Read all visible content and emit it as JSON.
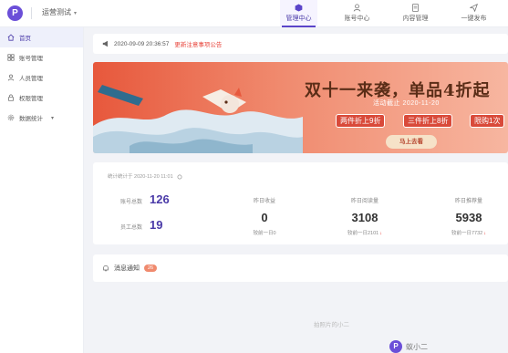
{
  "app": {
    "logo_glyph": "P",
    "org_name": "运营测试"
  },
  "top_nav": [
    {
      "label": "管理中心",
      "active": true
    },
    {
      "label": "账号中心",
      "active": false
    },
    {
      "label": "内容管理",
      "active": false
    },
    {
      "label": "一键发布",
      "active": false
    }
  ],
  "sidebar": {
    "items": [
      {
        "label": "首页",
        "icon": "home-icon",
        "active": true
      },
      {
        "label": "账号管理",
        "icon": "grid-icon",
        "active": false
      },
      {
        "label": "人员管理",
        "icon": "user-icon",
        "active": false
      },
      {
        "label": "权限管理",
        "icon": "lock-icon",
        "active": false
      },
      {
        "label": "数据统计",
        "icon": "settings-icon",
        "active": false
      }
    ]
  },
  "notice": {
    "time": "2020-09-09 20:36:57",
    "link_text": "更新注意事项公告"
  },
  "banner": {
    "title": "双十一来袭，单品4折起",
    "subtitle": "活动截止 2020-11-20",
    "chips": [
      "两件折上9折",
      "三件折上8折",
      "限购1次"
    ],
    "cta": "马上去看"
  },
  "stats": {
    "stat_time": "统计统计于 2020-11-20 11:01",
    "account_total_label": "账号总数",
    "account_total": "126",
    "staff_total_label": "员工总数",
    "staff_total": "19",
    "kpis": [
      {
        "label": "昨日收益",
        "value": "0",
        "compare": "较前一日0",
        "down": ""
      },
      {
        "label": "昨日阅读量",
        "value": "3108",
        "compare": "较前一日2101",
        "down": "↓"
      },
      {
        "label": "昨日推荐量",
        "value": "5938",
        "compare": "较前一日7732",
        "down": "↓"
      }
    ]
  },
  "messages": {
    "label": "消息通知",
    "count": "26"
  },
  "footer": {
    "text": "拍照片的小二",
    "brand": "蚁小二"
  },
  "colors": {
    "accent": "#5b45c9",
    "alert": "#e8453c"
  }
}
